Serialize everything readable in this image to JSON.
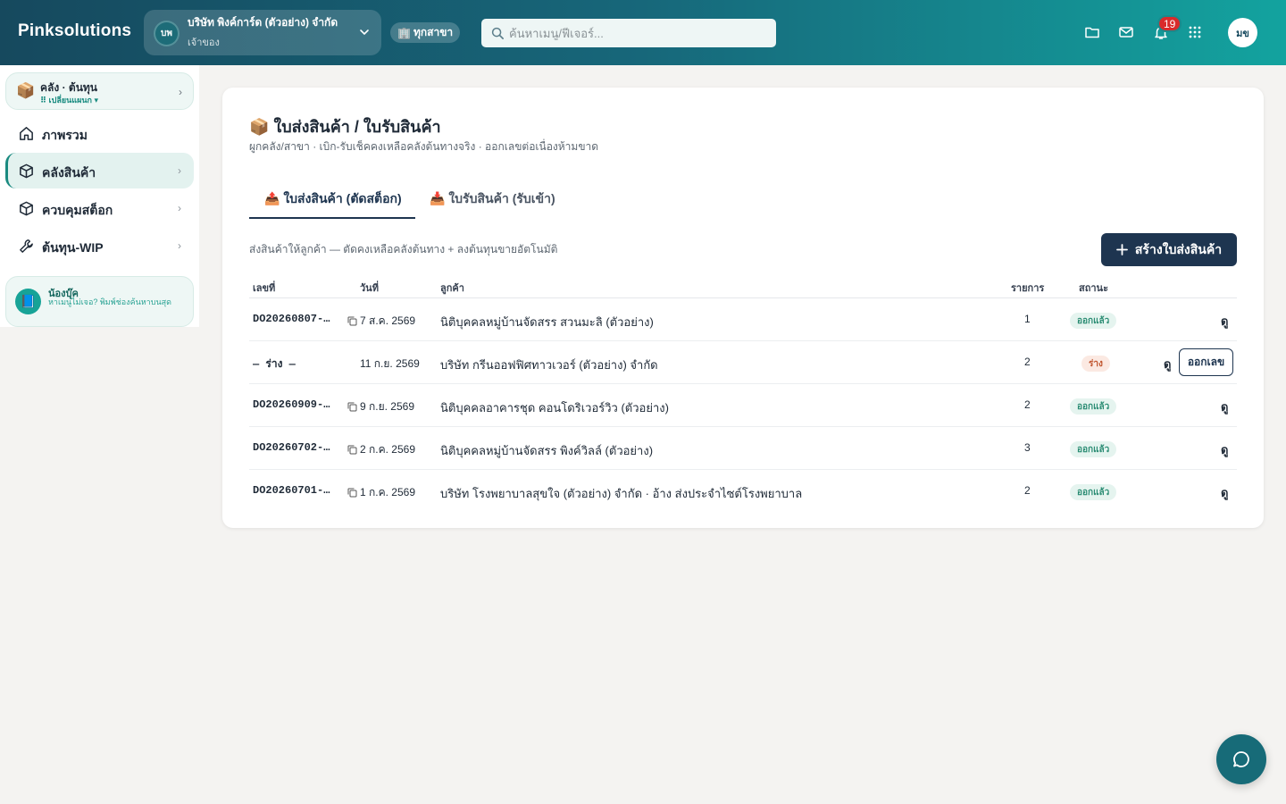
{
  "app": {
    "brand": "Pinksolutions"
  },
  "company": {
    "initials": "บพ",
    "name": "บริษัท พิงค์การ์ด (ตัวอย่าง) จำกัด",
    "role": "เจ้าของ"
  },
  "branch": {
    "icon": "🏢",
    "label": "ทุกสาขา"
  },
  "search": {
    "placeholder": "ค้นหาเมนู/ฟีเจอร์..."
  },
  "notifications": {
    "count": "19"
  },
  "user": {
    "initials": "มข"
  },
  "sidebar": {
    "module": {
      "icon": "📦",
      "title": "คลัง · ต้นทุน",
      "switch_label": "⠿ เปลี่ยนแผนก ▾"
    },
    "items": [
      {
        "label": "ภาพรวม",
        "icon": "home-icon"
      },
      {
        "label": "คลังสินค้า",
        "icon": "box-icon",
        "active": true
      },
      {
        "label": "ควบคุมสต็อก",
        "icon": "box-icon"
      },
      {
        "label": "ต้นทุน-WIP",
        "icon": "wrench-icon"
      }
    ],
    "helper": {
      "icon": "📘",
      "title": "น้องบุ๊ค",
      "desc": "หาเมนูไม่เจอ? พิมพ์ช่องค้นหาบนสุด"
    }
  },
  "page": {
    "icon": "📦",
    "title": "ใบส่งสินค้า / ใบรับสินค้า",
    "subtitle": "ผูกคลัง/สาขา · เบิก-รับเช็คคงเหลือคลังต้นทางจริง · ออกเลขต่อเนื่องห้ามขาด",
    "tabs": [
      {
        "icon": "📤",
        "label": "ใบส่งสินค้า (ตัดสต็อก)",
        "active": true
      },
      {
        "icon": "📥",
        "label": "ใบรับสินค้า (รับเข้า)",
        "active": false
      }
    ],
    "description": "ส่งสินค้าให้ลูกค้า — ตัดคงเหลือคลังต้นทาง + ลงต้นทุนขายอัตโนมัติ",
    "create_button": "สร้างใบส่งสินค้า"
  },
  "table": {
    "headers": {
      "no": "เลขที่",
      "date": "วันที่",
      "customer": "ลูกค้า",
      "items": "รายการ",
      "status": "สถานะ"
    },
    "view_label": "ดู",
    "issue_label": "ออกเลข",
    "rows": [
      {
        "no": "DO20260807-…",
        "date": "7 ส.ค. 2569",
        "customer": "นิติบุคคลหมู่บ้านจัดสรร สวนมะลิ (ตัวอย่าง)",
        "items": "1",
        "status": "ออกแล้ว"
      },
      {
        "no": "— ร่าง —",
        "date": "11 ก.ย. 2569",
        "customer": "บริษัท กรีนออฟฟิศทาวเวอร์ (ตัวอย่าง) จำกัด",
        "items": "2",
        "status": "ร่าง"
      },
      {
        "no": "DO20260909-…",
        "date": "9 ก.ย. 2569",
        "customer": "นิติบุคคลอาคารชุด คอนโดริเวอร์วิว (ตัวอย่าง)",
        "items": "2",
        "status": "ออกแล้ว"
      },
      {
        "no": "DO20260702-…",
        "date": "2 ก.ค. 2569",
        "customer": "นิติบุคคลหมู่บ้านจัดสรร พิงค์วิลล์ (ตัวอย่าง)",
        "items": "3",
        "status": "ออกแล้ว"
      },
      {
        "no": "DO20260701-…",
        "date": "1 ก.ค. 2569",
        "customer": "บริษัท โรงพยาบาลสุขใจ (ตัวอย่าง) จำกัด · อ้าง ส่งประจำไซต์โรงพยาบาล",
        "items": "2",
        "status": "ออกแล้ว"
      }
    ]
  },
  "colors": {
    "accent": "#1e3550",
    "teal": "#17a397",
    "issued_bg": "#e5f4ef",
    "draft_bg": "#fbe9e2"
  }
}
